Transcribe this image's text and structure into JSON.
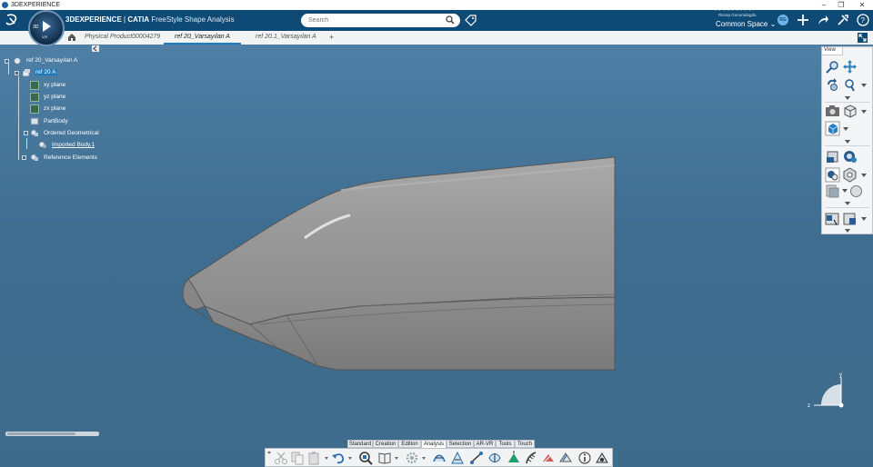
{
  "window": {
    "title": "3DEXPERIENCE",
    "controls": [
      "–",
      "❐",
      "✕"
    ]
  },
  "header": {
    "brand": "3DEXPERIENCE",
    "separator": " | ",
    "product": "CATIA",
    "app": "FreeStyle Shape Analysis",
    "compass_3d": "3D",
    "compass_version": "V,R",
    "search_placeholder": "Search",
    "user_partial": "· · ·  · · ·  · · ·",
    "user_name": "Recep Gunumdogdu",
    "space": "Common Space",
    "avatar": "RG"
  },
  "tabs": [
    {
      "label": "Physical Product00004279"
    },
    {
      "label": "ref 20_Varsayılan A"
    },
    {
      "label": "ref 20.1_Varsayılan A"
    },
    {
      "label": "+"
    }
  ],
  "tree": {
    "root": "ref 20_Varsayılan A",
    "part": "ref 20 A",
    "items": [
      {
        "label": "xy plane"
      },
      {
        "label": "yz plane"
      },
      {
        "label": "zx plane"
      },
      {
        "label": "PartBody"
      },
      {
        "label": "Ordered Geometrical"
      },
      {
        "label": "Imported Body.1"
      },
      {
        "label": "Reference Elements"
      }
    ]
  },
  "view_panel": {
    "title": "View"
  },
  "axis": {
    "y": "y",
    "z": "z"
  },
  "action_tabs": [
    "Standard",
    "Creation",
    "Edition",
    "Analysis",
    "Selection",
    "AR-VR",
    "Tools",
    "Touch"
  ],
  "active_action_tab": "Analysis",
  "colors": {
    "header_bg": "#0f4a76",
    "viewport_bg": "#3e6d90",
    "accent": "#1f7bc0",
    "model_gray": "#8e8e8e"
  }
}
